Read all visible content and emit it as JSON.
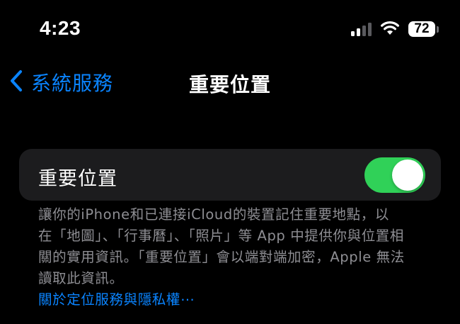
{
  "status_bar": {
    "time": "4:23",
    "signal_strength": 2,
    "wifi": "wifi-icon",
    "battery_level": "72"
  },
  "nav": {
    "back_label": "系統服務",
    "title": "重要位置"
  },
  "settings": {
    "significant_locations": {
      "label": "重要位置",
      "enabled": true
    }
  },
  "footer": {
    "description_lines": [
      "讓你的iPhone和已連接iCloud的裝置記住重要地點，以",
      "在「地圖」、「行事曆」、「照片」等 App 中提供你與位置相",
      "關的實用資訊。「重要位置」會以端對端加密，Apple 無法",
      "讀取此資訊。"
    ],
    "link": "關於定位服務與隱私權⋯"
  },
  "colors": {
    "background": "#000000",
    "cell_background": "#1c1c1e",
    "accent_blue": "#0a84ff",
    "toggle_on": "#30d158",
    "secondary_text": "#8e8e93"
  }
}
